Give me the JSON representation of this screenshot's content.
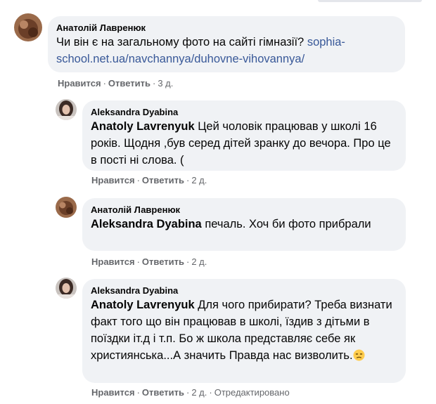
{
  "comments": [
    {
      "author": "Анатолій Лавренюк",
      "text_parts": [
        "Чи він є на загальному фото на сайті гімназії? "
      ],
      "link": "sophia-school.net.ua/navchannya/duhovne-vihovannya/",
      "like": "Нравится",
      "reply": "Ответить",
      "sep": "·",
      "time": "3 д."
    },
    {
      "author": "Aleksandra Dyabina",
      "mention": "Anatoly Lavrenyuk",
      "text": " Цей чоловік працював у школі 16 років. Щодня ,був серед дітей зранку до вечора. Про це в пості ні слова. (",
      "like": "Нравится",
      "reply": "Ответить",
      "sep": "·",
      "time": "2 д."
    },
    {
      "author": "Анатолій Лавренюк",
      "mention": "Aleksandra Dyabina",
      "text": " печаль. Хоч би фото прибрали",
      "like": "Нравится",
      "reply": "Ответить",
      "sep": "·",
      "time": "2 д."
    },
    {
      "author": "Aleksandra Dyabina",
      "mention": "Anatoly Lavrenyuk",
      "text": " Для чого прибирати? Треба визнати факт того що він працював в школі, їздив з дітьми в поїздки іт.д і т.п. Бо ж школа представляє себе як християнська...А значить Правда нас визволить.",
      "emoji": "unamused-face-emoji",
      "like": "Нравится",
      "reply": "Ответить",
      "sep": "·",
      "time": "2 д.",
      "edited": "Отредактировано"
    }
  ],
  "colors": {
    "bubble": "#f0f2f5",
    "text": "#050505",
    "meta": "#65676b",
    "link": "#385898"
  }
}
